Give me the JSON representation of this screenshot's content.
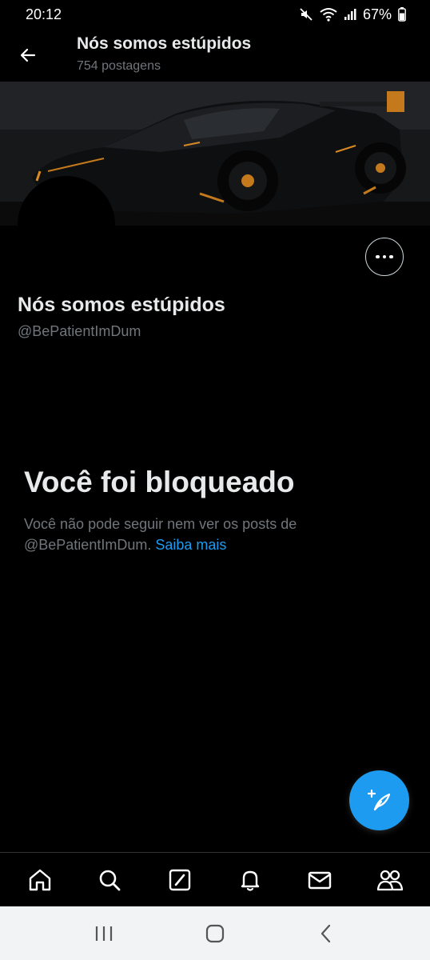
{
  "status_bar": {
    "time": "20:12",
    "battery": "67%"
  },
  "header": {
    "title": "Nós somos estúpidos",
    "subtitle": "754 postagens"
  },
  "profile": {
    "name": "Nós somos estúpidos",
    "handle": "@BePatientImDum"
  },
  "blocked": {
    "title": "Você foi bloqueado",
    "description": "Você não pode seguir nem ver os posts de @BePatientImDum.",
    "link": "Saiba mais"
  },
  "icons": {
    "back": "arrow-left-icon",
    "more": "more-horizontal-icon",
    "compose": "compose-post-icon",
    "nav": [
      "home-icon",
      "search-icon",
      "grok-icon",
      "notifications-icon",
      "messages-icon",
      "communities-icon"
    ],
    "system": [
      "recent-apps-icon",
      "home-circle-icon",
      "back-chevron-icon"
    ]
  },
  "colors": {
    "accent": "#1d9bf0",
    "background": "#000000",
    "muted_text": "#71767b"
  }
}
